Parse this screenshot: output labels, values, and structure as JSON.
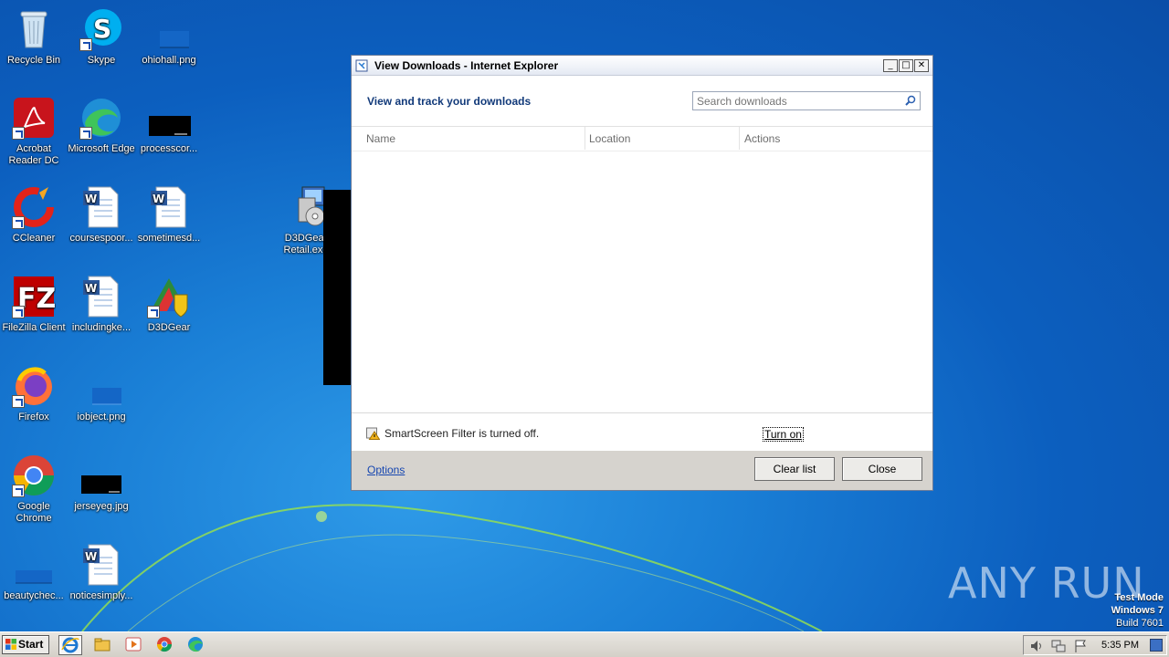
{
  "desktop": {
    "icons": [
      {
        "label": "Recycle Bin"
      },
      {
        "label": "Skype"
      },
      {
        "label": "ohiohall.png"
      },
      {
        "label": "Acrobat Reader DC"
      },
      {
        "label": "Microsoft Edge"
      },
      {
        "label": "processcor..."
      },
      {
        "label": "CCleaner"
      },
      {
        "label": "coursespoor..."
      },
      {
        "label": "sometimesd..."
      },
      {
        "label": "D3DGear Retail.exe"
      },
      {
        "label": "FileZilla Client"
      },
      {
        "label": "includingke..."
      },
      {
        "label": "D3DGear"
      },
      {
        "label": "Firefox"
      },
      {
        "label": "iobject.png"
      },
      {
        "label": "Google Chrome"
      },
      {
        "label": "jerseyeg.jpg"
      },
      {
        "label": "beautychec..."
      },
      {
        "label": "noticesimply..."
      }
    ]
  },
  "window": {
    "title": "View Downloads - Internet Explorer",
    "controls": {
      "minimize": "_",
      "maximize": "□",
      "close": "✕"
    },
    "heading": "View and track your downloads",
    "search_placeholder": "Search downloads",
    "columns": [
      "Name",
      "Location",
      "Actions"
    ],
    "smartscreen_text": "SmartScreen Filter is turned off.",
    "turn_on_label": "Turn on",
    "options_label": "Options",
    "clear_list_label": "Clear list",
    "close_label": "Close"
  },
  "watermark": {
    "brand": "ANY RUN",
    "mode_line1": "Test Mode",
    "mode_line2": "Windows 7",
    "mode_line3": "Build 7601"
  },
  "taskbar": {
    "start_label": "Start",
    "clock": "5:35 PM",
    "pinned": [
      "internet-explorer-icon",
      "explorer-folder-icon",
      "media-player-icon",
      "chrome-icon",
      "edge-icon"
    ]
  }
}
